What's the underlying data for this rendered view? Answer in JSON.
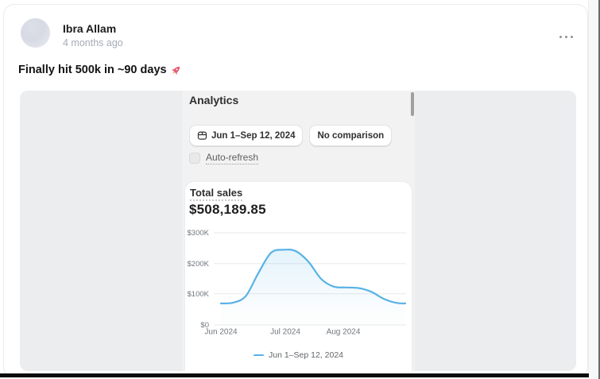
{
  "post": {
    "author": "Ibra Allam",
    "timestamp": "4 months ago",
    "text": "Finally hit 500k in ~90 days",
    "emoji": "🚀"
  },
  "analytics": {
    "title": "Analytics",
    "date_range_button": "Jun 1–Sep 12, 2024",
    "comparison_button": "No comparison",
    "auto_refresh_label": "Auto-refresh",
    "metric_label": "Total sales",
    "metric_value": "$508,189.85",
    "legend": "Jun 1–Sep 12, 2024"
  },
  "colors": {
    "line_blue": "#58b2e6",
    "panel_bg": "#f2f2f2",
    "embed_bg": "#ebedef",
    "text_dark": "#303030",
    "text_gray": "#616161"
  },
  "chart_data": {
    "type": "line",
    "title": "Total sales",
    "total_value": "$508,189.85",
    "series": [
      {
        "name": "Jun 1–Sep 12, 2024",
        "x_dates": [
          "Jun 1",
          "Jun 8",
          "Jun 15",
          "Jun 22",
          "Jun 29",
          "Jul 6",
          "Jul 13",
          "Jul 20",
          "Jul 27",
          "Aug 3",
          "Aug 10",
          "Aug 17",
          "Aug 24",
          "Aug 31",
          "Sep 7",
          "Sep 12"
        ],
        "x_days": [
          0,
          7,
          14,
          21,
          28,
          35,
          42,
          49,
          56,
          63,
          70,
          77,
          84,
          91,
          98,
          103
        ],
        "values": [
          70000,
          73000,
          95000,
          170000,
          235000,
          245000,
          240000,
          205000,
          150000,
          125000,
          122000,
          120000,
          108000,
          85000,
          72000,
          70000
        ]
      }
    ],
    "yticks": [
      "$300K",
      "$200K",
      "$100K",
      "$0"
    ],
    "ytick_values": [
      300000,
      200000,
      100000,
      0
    ],
    "xticks": [
      "Jun 2024",
      "Jul 2024",
      "Aug 2024"
    ],
    "ylim": [
      0,
      300000
    ],
    "grid": "horizontal",
    "legend_position": "bottom",
    "line_color": "#58b2e6"
  }
}
